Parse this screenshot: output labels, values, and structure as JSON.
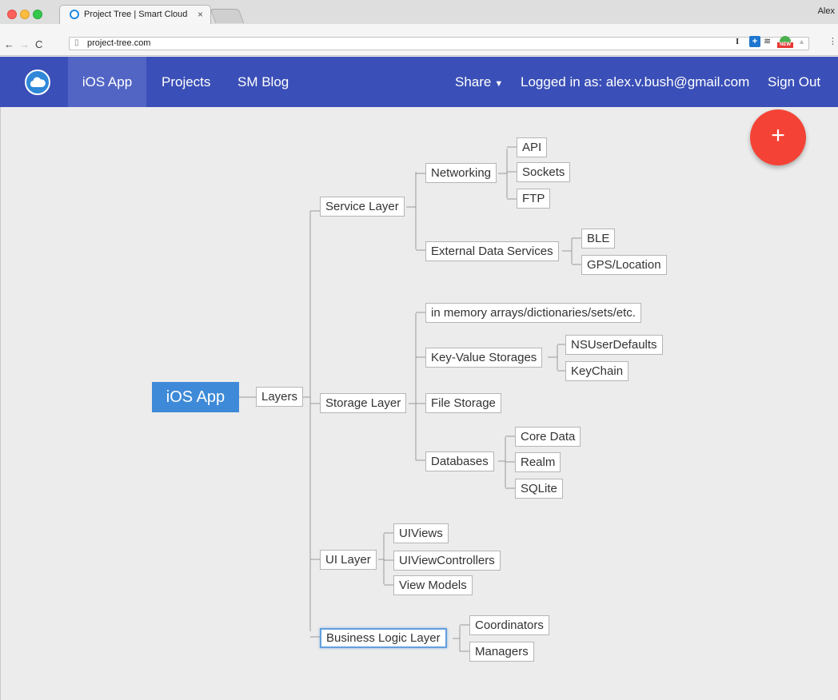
{
  "browser": {
    "tab_title": "Project Tree | Smart Cloud",
    "tab_close": "×",
    "user_name": "Alex",
    "url": "project-tree.com",
    "ext_badge": "NEW",
    "icons": [
      "back-icon",
      "forward-icon",
      "reload-icon",
      "page-icon",
      "menu-icon"
    ]
  },
  "navbar": {
    "links": {
      "ios_app": "iOS App",
      "projects": "Projects",
      "blog": "SM Blog",
      "share": "Share",
      "logged_in": "Logged in as: alex.v.bush@gmail.com",
      "sign_out": "Sign Out"
    },
    "accent": "#3a4fb7"
  },
  "fab": {
    "label": "+",
    "color": "#f44336"
  },
  "tree": {
    "root": "iOS App",
    "layers": "Layers",
    "service_layer": {
      "label": "Service Layer",
      "networking": {
        "label": "Networking",
        "children": [
          "API",
          "Sockets",
          "FTP"
        ]
      },
      "external": {
        "label": "External Data Services",
        "children": [
          "BLE",
          "GPS/Location"
        ]
      }
    },
    "storage_layer": {
      "label": "Storage Layer",
      "in_memory": "in memory arrays/dictionaries/sets/etc.",
      "key_value": {
        "label": "Key-Value Storages",
        "children": [
          "NSUserDefaults",
          "KeyChain"
        ]
      },
      "file_storage": "File Storage",
      "databases": {
        "label": "Databases",
        "children": [
          "Core Data",
          "Realm",
          "SQLite"
        ]
      }
    },
    "ui_layer": {
      "label": "UI Layer",
      "children": [
        "UIViews",
        "UIViewControllers",
        "View Models"
      ]
    },
    "business_layer": {
      "label": "Business Logic Layer",
      "children": [
        "Coordinators",
        "Managers"
      ]
    }
  }
}
